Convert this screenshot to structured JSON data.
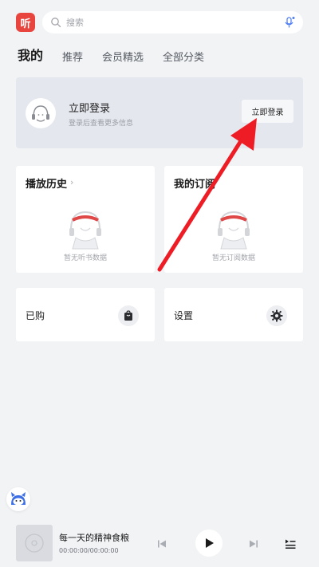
{
  "app": {
    "logo_text": "听"
  },
  "search": {
    "placeholder": "搜索"
  },
  "tabs": [
    {
      "label": "我的",
      "active": true
    },
    {
      "label": "推荐"
    },
    {
      "label": "会员精选"
    },
    {
      "label": "全部分类"
    }
  ],
  "login_card": {
    "title": "立即登录",
    "subtitle": "登录后查看更多信息",
    "button_label": "立即登录"
  },
  "history": {
    "title": "播放历史",
    "chevron": "›",
    "empty_text": "暂无听书数据"
  },
  "subscriptions": {
    "title": "我的订阅",
    "empty_text": "暂无订阅数据"
  },
  "purchased": {
    "label": "已购"
  },
  "settings": {
    "label": "设置"
  },
  "player": {
    "title": "每一天的精神食粮",
    "time": "00:00:00/00:00:00"
  },
  "colors": {
    "accent": "#e9453f",
    "arrow": "#ee1c24",
    "background": "#f2f3f5"
  }
}
